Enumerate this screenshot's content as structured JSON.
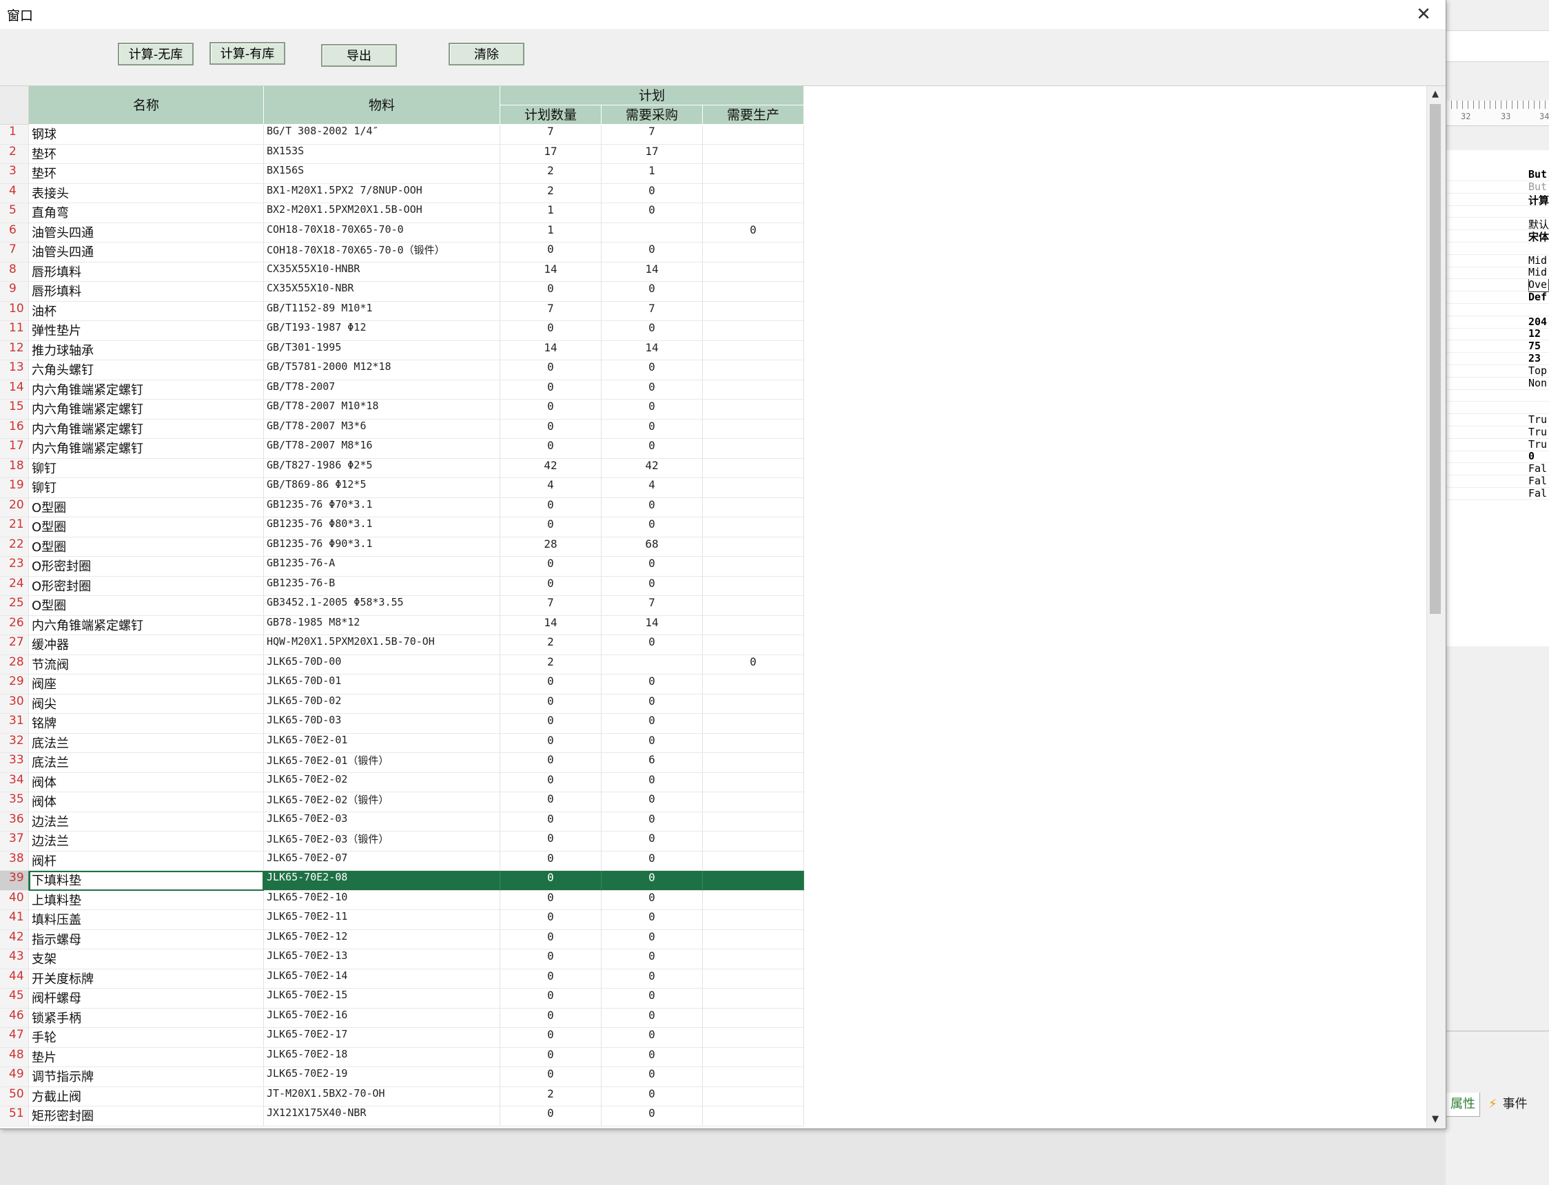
{
  "window": {
    "title": "窗口",
    "close_glyph": "✕"
  },
  "toolbar": {
    "calc_no_stock": "计算-无库",
    "calc_with_stock": "计算-有库",
    "export": "导出",
    "clear": "清除"
  },
  "table": {
    "headers": {
      "name": "名称",
      "material": "物料",
      "plan_group": "计划",
      "plan_qty": "计划数量",
      "need_purchase": "需要采购",
      "need_produce": "需要生产"
    },
    "selected_row": 39,
    "rows": [
      {
        "idx": "1",
        "name": "钢球",
        "material": "BG/T 308-2002 1/4″",
        "qty": "7",
        "purchase": "7",
        "produce": ""
      },
      {
        "idx": "2",
        "name": "垫环",
        "material": "BX153S",
        "qty": "17",
        "purchase": "17",
        "produce": ""
      },
      {
        "idx": "3",
        "name": "垫环",
        "material": "BX156S",
        "qty": "2",
        "purchase": "1",
        "produce": ""
      },
      {
        "idx": "4",
        "name": "表接头",
        "material": "BX1-M20X1.5PX2 7/8NUP-OOH",
        "qty": "2",
        "purchase": "0",
        "produce": ""
      },
      {
        "idx": "5",
        "name": "直角弯",
        "material": "BX2-M20X1.5PXM20X1.5B-OOH",
        "qty": "1",
        "purchase": "0",
        "produce": ""
      },
      {
        "idx": "6",
        "name": "油管头四通",
        "material": "COH18-70X18-70X65-70-0",
        "qty": "1",
        "purchase": "",
        "produce": "0"
      },
      {
        "idx": "7",
        "name": "油管头四通",
        "material": "COH18-70X18-70X65-70-0（锻件）",
        "qty": "0",
        "purchase": "0",
        "produce": ""
      },
      {
        "idx": "8",
        "name": "唇形填料",
        "material": "CX35X55X10-HNBR",
        "qty": "14",
        "purchase": "14",
        "produce": ""
      },
      {
        "idx": "9",
        "name": "唇形填料",
        "material": "CX35X55X10-NBR",
        "qty": "0",
        "purchase": "0",
        "produce": ""
      },
      {
        "idx": "10",
        "name": "油杯",
        "material": "GB/T1152-89 M10*1",
        "qty": "7",
        "purchase": "7",
        "produce": ""
      },
      {
        "idx": "11",
        "name": "弹性垫片",
        "material": "GB/T193-1987 Φ12",
        "qty": "0",
        "purchase": "0",
        "produce": ""
      },
      {
        "idx": "12",
        "name": "推力球轴承",
        "material": "GB/T301-1995",
        "qty": "14",
        "purchase": "14",
        "produce": ""
      },
      {
        "idx": "13",
        "name": "六角头螺钉",
        "material": "GB/T5781-2000 M12*18",
        "qty": "0",
        "purchase": "0",
        "produce": ""
      },
      {
        "idx": "14",
        "name": "内六角锥端紧定螺钉",
        "material": "GB/T78-2007",
        "qty": "0",
        "purchase": "0",
        "produce": ""
      },
      {
        "idx": "15",
        "name": "内六角锥端紧定螺钉",
        "material": "GB/T78-2007 M10*18",
        "qty": "0",
        "purchase": "0",
        "produce": ""
      },
      {
        "idx": "16",
        "name": "内六角锥端紧定螺钉",
        "material": "GB/T78-2007 M3*6",
        "qty": "0",
        "purchase": "0",
        "produce": ""
      },
      {
        "idx": "17",
        "name": "内六角锥端紧定螺钉",
        "material": "GB/T78-2007 M8*16",
        "qty": "0",
        "purchase": "0",
        "produce": ""
      },
      {
        "idx": "18",
        "name": "铆钉",
        "material": "GB/T827-1986 Φ2*5",
        "qty": "42",
        "purchase": "42",
        "produce": ""
      },
      {
        "idx": "19",
        "name": "铆钉",
        "material": "GB/T869-86 Φ12*5",
        "qty": "4",
        "purchase": "4",
        "produce": ""
      },
      {
        "idx": "20",
        "name": "O型圈",
        "material": "GB1235-76 Φ70*3.1",
        "qty": "0",
        "purchase": "0",
        "produce": ""
      },
      {
        "idx": "21",
        "name": "O型圈",
        "material": "GB1235-76 Φ80*3.1",
        "qty": "0",
        "purchase": "0",
        "produce": ""
      },
      {
        "idx": "22",
        "name": "O型圈",
        "material": "GB1235-76 Φ90*3.1",
        "qty": "28",
        "purchase": "68",
        "produce": ""
      },
      {
        "idx": "23",
        "name": "O形密封圈",
        "material": "GB1235-76-A",
        "qty": "0",
        "purchase": "0",
        "produce": ""
      },
      {
        "idx": "24",
        "name": "O形密封圈",
        "material": "GB1235-76-B",
        "qty": "0",
        "purchase": "0",
        "produce": ""
      },
      {
        "idx": "25",
        "name": "O型圈",
        "material": "GB3452.1-2005 Φ58*3.55",
        "qty": "7",
        "purchase": "7",
        "produce": ""
      },
      {
        "idx": "26",
        "name": "内六角锥端紧定螺钉",
        "material": "GB78-1985 M8*12",
        "qty": "14",
        "purchase": "14",
        "produce": ""
      },
      {
        "idx": "27",
        "name": "缓冲器",
        "material": "HQW-M20X1.5PXM20X1.5B-70-OH",
        "qty": "2",
        "purchase": "0",
        "produce": ""
      },
      {
        "idx": "28",
        "name": "节流阀",
        "material": "JLK65-70D-00",
        "qty": "2",
        "purchase": "",
        "produce": "0"
      },
      {
        "idx": "29",
        "name": "阀座",
        "material": "JLK65-70D-01",
        "qty": "0",
        "purchase": "0",
        "produce": ""
      },
      {
        "idx": "30",
        "name": "阀尖",
        "material": "JLK65-70D-02",
        "qty": "0",
        "purchase": "0",
        "produce": ""
      },
      {
        "idx": "31",
        "name": "铭牌",
        "material": "JLK65-70D-03",
        "qty": "0",
        "purchase": "0",
        "produce": ""
      },
      {
        "idx": "32",
        "name": "底法兰",
        "material": "JLK65-70E2-01",
        "qty": "0",
        "purchase": "0",
        "produce": ""
      },
      {
        "idx": "33",
        "name": "底法兰",
        "material": "JLK65-70E2-01（锻件）",
        "qty": "0",
        "purchase": "6",
        "produce": ""
      },
      {
        "idx": "34",
        "name": "阀体",
        "material": "JLK65-70E2-02",
        "qty": "0",
        "purchase": "0",
        "produce": ""
      },
      {
        "idx": "35",
        "name": "阀体",
        "material": "JLK65-70E2-02（锻件）",
        "qty": "0",
        "purchase": "0",
        "produce": ""
      },
      {
        "idx": "36",
        "name": "边法兰",
        "material": "JLK65-70E2-03",
        "qty": "0",
        "purchase": "0",
        "produce": ""
      },
      {
        "idx": "37",
        "name": "边法兰",
        "material": "JLK65-70E2-03（锻件）",
        "qty": "0",
        "purchase": "0",
        "produce": ""
      },
      {
        "idx": "38",
        "name": "阀杆",
        "material": "JLK65-70E2-07",
        "qty": "0",
        "purchase": "0",
        "produce": ""
      },
      {
        "idx": "39",
        "name": "下填料垫",
        "material": "JLK65-70E2-08",
        "qty": "0",
        "purchase": "0",
        "produce": ""
      },
      {
        "idx": "40",
        "name": "上填料垫",
        "material": "JLK65-70E2-10",
        "qty": "0",
        "purchase": "0",
        "produce": ""
      },
      {
        "idx": "41",
        "name": "填料压盖",
        "material": "JLK65-70E2-11",
        "qty": "0",
        "purchase": "0",
        "produce": ""
      },
      {
        "idx": "42",
        "name": "指示螺母",
        "material": "JLK65-70E2-12",
        "qty": "0",
        "purchase": "0",
        "produce": ""
      },
      {
        "idx": "43",
        "name": "支架",
        "material": "JLK65-70E2-13",
        "qty": "0",
        "purchase": "0",
        "produce": ""
      },
      {
        "idx": "44",
        "name": "开关度标牌",
        "material": "JLK65-70E2-14",
        "qty": "0",
        "purchase": "0",
        "produce": ""
      },
      {
        "idx": "45",
        "name": "阀杆螺母",
        "material": "JLK65-70E2-15",
        "qty": "0",
        "purchase": "0",
        "produce": ""
      },
      {
        "idx": "46",
        "name": "锁紧手柄",
        "material": "JLK65-70E2-16",
        "qty": "0",
        "purchase": "0",
        "produce": ""
      },
      {
        "idx": "47",
        "name": "手轮",
        "material": "JLK65-70E2-17",
        "qty": "0",
        "purchase": "0",
        "produce": ""
      },
      {
        "idx": "48",
        "name": "垫片",
        "material": "JLK65-70E2-18",
        "qty": "0",
        "purchase": "0",
        "produce": ""
      },
      {
        "idx": "49",
        "name": "调节指示牌",
        "material": "JLK65-70E2-19",
        "qty": "0",
        "purchase": "0",
        "produce": ""
      },
      {
        "idx": "50",
        "name": "方截止阀",
        "material": "JT-M20X1.5BX2-70-OH",
        "qty": "2",
        "purchase": "0",
        "produce": ""
      },
      {
        "idx": "51",
        "name": "矩形密封圈",
        "material": "JX121X175X40-NBR",
        "qty": "0",
        "purchase": "0",
        "produce": ""
      }
    ]
  },
  "scrollbar": {
    "up_glyph": "▲",
    "down_glyph": "▼"
  },
  "ide_panel": {
    "ruler_labels": [
      "32",
      "33",
      "34"
    ],
    "properties": [
      "But",
      "But",
      "计算",
      "",
      "默认",
      "宋体",
      "",
      "Mid",
      "Mid",
      "Ove",
      "Def",
      "",
      "204",
      "12",
      "75",
      "23",
      "Top",
      "Non",
      "",
      "",
      "Tru",
      "Tru",
      "Tru",
      "0",
      "Fal",
      "Fal",
      "Fal"
    ],
    "tab_properties": "属性",
    "tab_events": "事件"
  }
}
